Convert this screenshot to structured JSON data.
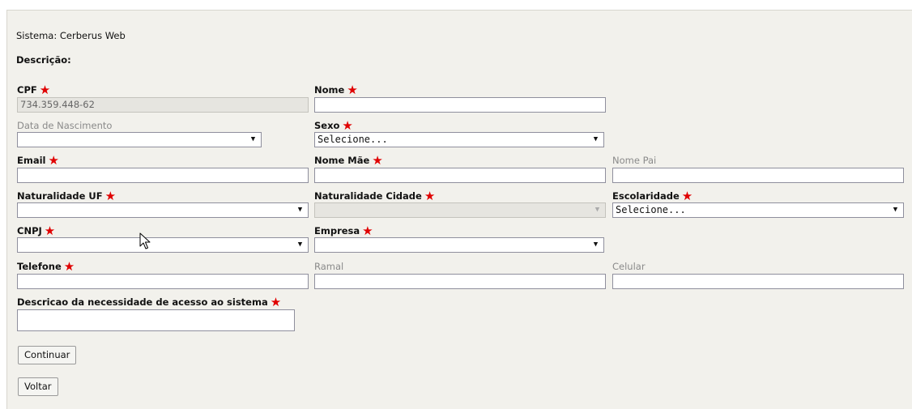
{
  "header": {
    "sistema_label": "Sistema:",
    "sistema_value": "Cerberus Web",
    "descricao_label": "Descrição:"
  },
  "fields": {
    "cpf": {
      "label": "CPF",
      "value": "734.359.448-62"
    },
    "nome": {
      "label": "Nome",
      "value": ""
    },
    "data_nascimento": {
      "label": "Data de Nascimento",
      "value": ""
    },
    "sexo": {
      "label": "Sexo",
      "value": "Selecione..."
    },
    "email": {
      "label": "Email",
      "value": ""
    },
    "nome_mae": {
      "label": "Nome Mãe",
      "value": ""
    },
    "nome_pai": {
      "label": "Nome Pai",
      "value": ""
    },
    "naturalidade_uf": {
      "label": "Naturalidade UF",
      "value": ""
    },
    "naturalidade_cidade": {
      "label": "Naturalidade Cidade",
      "value": ""
    },
    "escolaridade": {
      "label": "Escolaridade",
      "value": "Selecione..."
    },
    "cnpj": {
      "label": "CNPJ",
      "value": ""
    },
    "empresa": {
      "label": "Empresa",
      "value": ""
    },
    "telefone": {
      "label": "Telefone",
      "value": ""
    },
    "ramal": {
      "label": "Ramal",
      "value": ""
    },
    "celular": {
      "label": "Celular",
      "value": ""
    },
    "descricao_necessidade": {
      "label": "Descricao da necessidade de acesso ao sistema",
      "value": ""
    }
  },
  "buttons": {
    "continuar": "Continuar",
    "voltar": "Voltar"
  },
  "icons": {
    "required": "red-star-icon",
    "dropdown": "triangle-down-icon",
    "cursor": "mouse-pointer-icon"
  },
  "colors": {
    "required_star": "#e00000",
    "panel_background": "#f2f1ec",
    "disabled_field": "#e6e5e0"
  }
}
